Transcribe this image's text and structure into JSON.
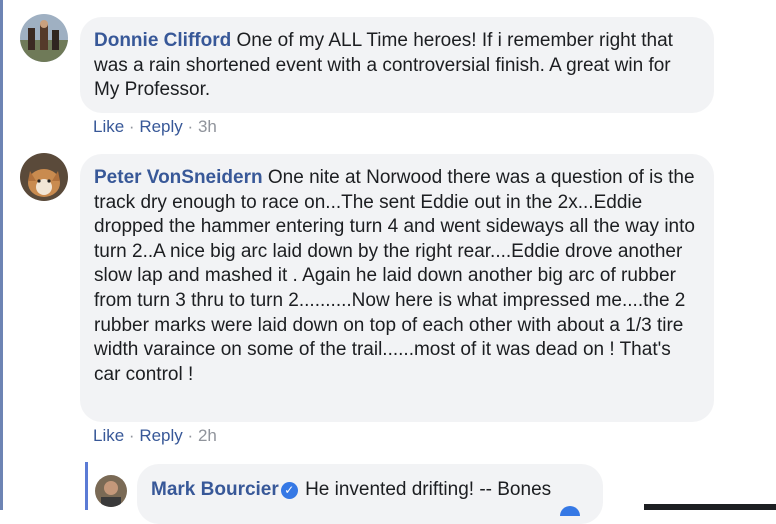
{
  "comments": [
    {
      "author": "Donnie Clifford",
      "text": "One of my ALL Time heroes! If i remember right that was a rain shortened event with a controversial finish. A great win for My Professor.",
      "like": "Like",
      "reply": "Reply",
      "time": "3h"
    },
    {
      "author": "Peter VonSneidern",
      "text": "One nite at Norwood there was a question of is the track dry enough to race on...The sent Eddie out in the 2x...Eddie dropped the hammer entering turn 4 and went sideways all the way into turn 2..A nice big arc laid down by the right rear....Eddie drove another slow lap and mashed it . Again he laid down another big arc of rubber from turn 3 thru to turn 2..........Now here is what impressed me....the 2 rubber marks were laid down on top of each other with about a 1/3 tire width varaince on some of the trail......most of it was dead on ! That's car control !",
      "like": "Like",
      "reply": "Reply",
      "time": "2h"
    }
  ],
  "reply": {
    "author": "Mark Bourcier",
    "text": "He invented drifting! -- Bones",
    "badge_icon": "verified-badge-icon"
  },
  "separator": "·"
}
